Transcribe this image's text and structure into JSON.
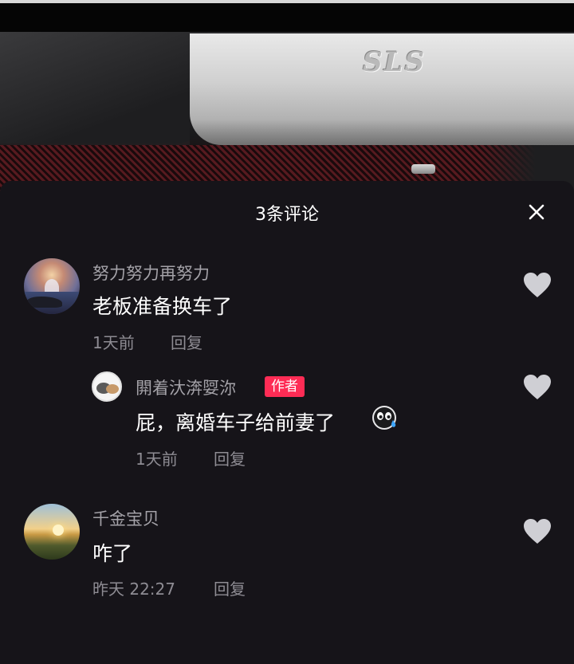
{
  "header": {
    "title": "3条评论"
  },
  "video": {
    "logo_text": "SLS"
  },
  "comments": [
    {
      "username": "努力努力再努力",
      "text": "老板准备换车了",
      "time": "1天前",
      "reply_label": "回复"
    },
    {
      "username": "閞着汏渀娿沵",
      "badge": "作者",
      "text": "屁，离婚车子给前妻了",
      "emoji_icon": "sweat-face-emoji",
      "time": "1天前",
      "reply_label": "回复"
    },
    {
      "username": "千金宝贝",
      "text": "咋了",
      "time": "昨天 22:27",
      "reply_label": "回复"
    }
  ],
  "colors": {
    "background": "#161419",
    "badge": "#fe2c55",
    "heart": "#cfcfd4"
  }
}
